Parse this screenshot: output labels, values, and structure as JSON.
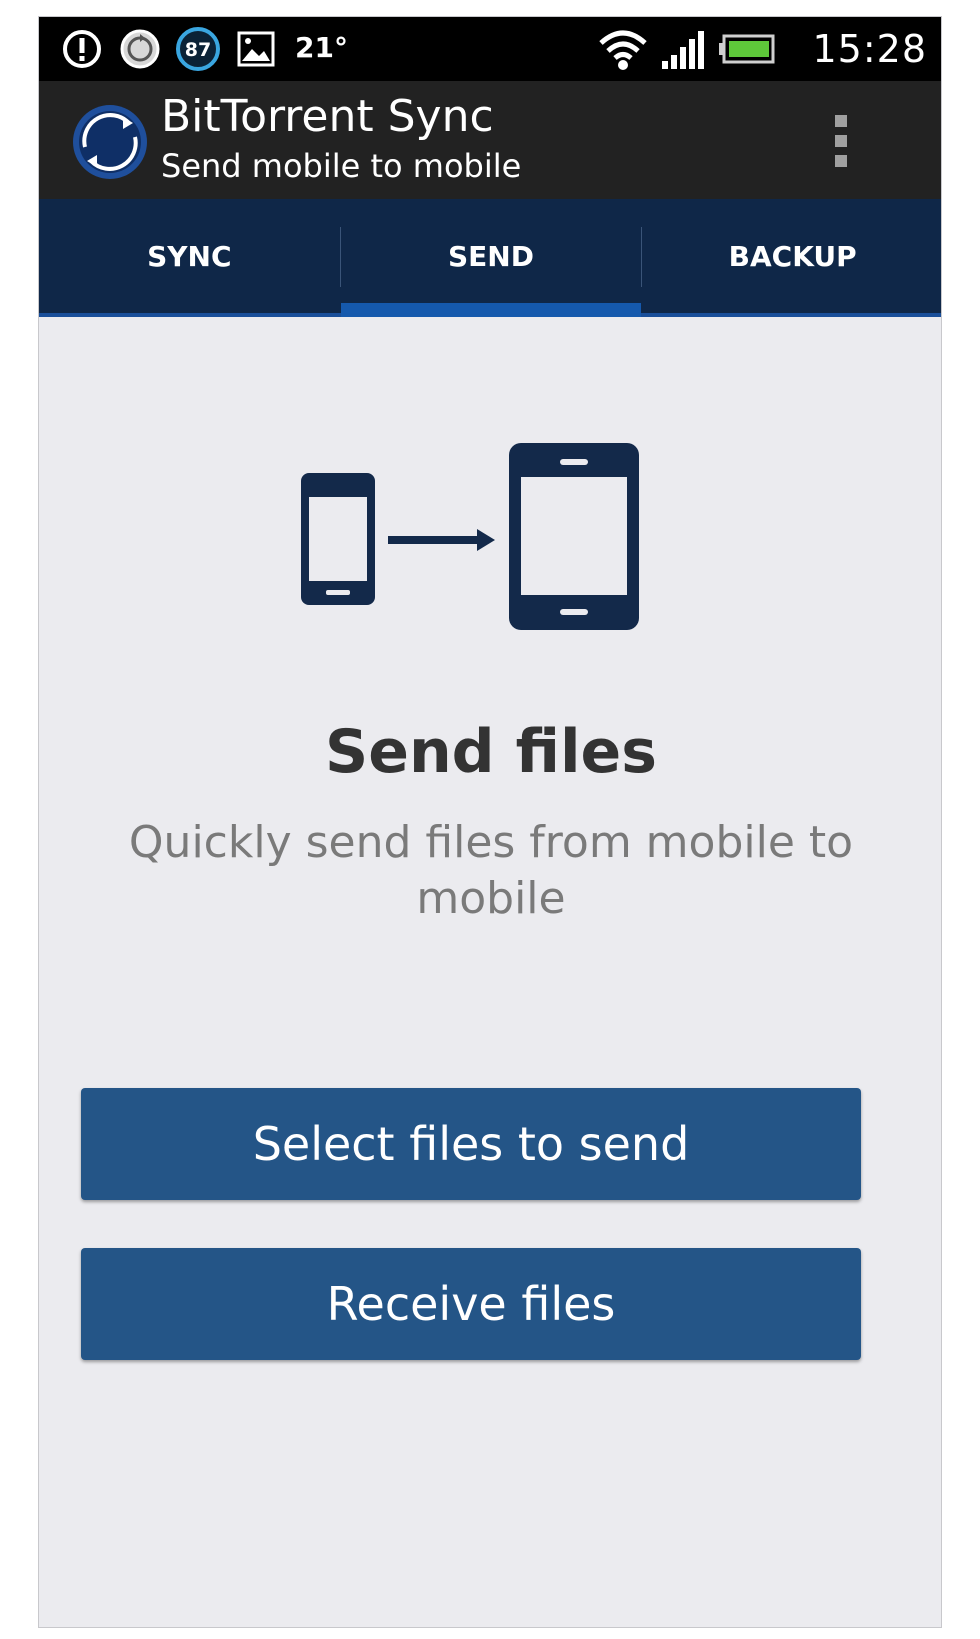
{
  "status_bar": {
    "icons": [
      "alert-icon",
      "sync-status-icon",
      "battery-percent-icon",
      "gallery-icon"
    ],
    "battery_percent": "87",
    "temperature": "21°",
    "right_icons": [
      "wifi-icon",
      "signal-icon",
      "battery-icon"
    ],
    "clock": "15:28"
  },
  "action_bar": {
    "title": "BitTorrent Sync",
    "subtitle": "Send mobile to mobile",
    "logo_icon": "bittorrent-sync-logo",
    "menu_icon": "overflow-menu-icon"
  },
  "tabs": [
    {
      "label": "SYNC",
      "active": false
    },
    {
      "label": "SEND",
      "active": true
    },
    {
      "label": "BACKUP",
      "active": false
    }
  ],
  "main": {
    "illustration_icon": "phone-to-tablet-icon",
    "heading": "Send files",
    "description": "Quickly send files from mobile to mobile",
    "primary_button": "Select files to send",
    "secondary_button": "Receive files"
  },
  "colors": {
    "tab_background": "#0f2748",
    "tab_indicator": "#1559ad",
    "button_background": "#245587",
    "illustration": "#13294a",
    "content_background": "#ebebef"
  }
}
